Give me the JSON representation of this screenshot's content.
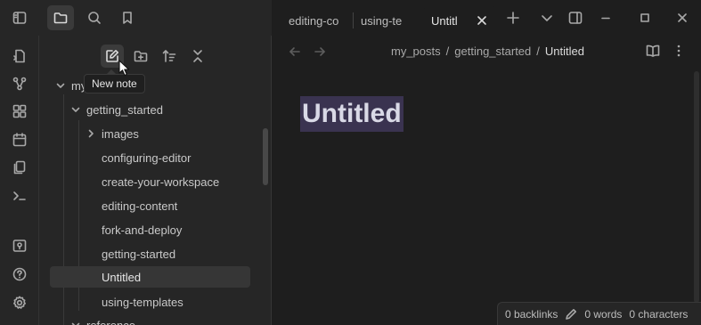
{
  "titlebar": {
    "tabs": [
      {
        "label": "editing-co",
        "active": false
      },
      {
        "label": "using-te",
        "active": false
      },
      {
        "label": "Untitl",
        "active": true
      }
    ],
    "icons": [
      "sidebar-toggle-icon",
      "folder-icon",
      "search-icon",
      "bookmark-icon",
      "plus-icon",
      "chevron-down-icon",
      "right-sidebar-icon",
      "minimize-icon",
      "maximize-icon",
      "close-icon"
    ]
  },
  "ribbon": {
    "icons": [
      "quick-switch-icon",
      "graph-icon",
      "canvas-icon",
      "calendar-icon",
      "templates-icon",
      "terminal-icon",
      "vault-icon",
      "help-icon",
      "settings-icon"
    ]
  },
  "sidebar": {
    "tools": [
      "new-note-icon",
      "new-folder-icon",
      "sort-icon",
      "collapse-all-icon"
    ],
    "tooltip": "New note",
    "tree": {
      "root": "my_posts",
      "folder": "getting_started",
      "subfolder": "images",
      "files": [
        "configuring-editor",
        "create-your-workspace",
        "editing-content",
        "fork-and-deploy",
        "getting-started",
        "Untitled",
        "using-templates"
      ],
      "next_folder": "reference"
    }
  },
  "editor": {
    "breadcrumb": {
      "root": "my_posts",
      "folder": "getting_started",
      "current": "Untitled",
      "sep": "/"
    },
    "title": "Untitled"
  },
  "status": {
    "backlinks": "0 backlinks",
    "words": "0 words",
    "characters": "0 characters"
  },
  "colors": {
    "accent_selection": "#3a3350",
    "background": "#1e1e1e",
    "sidebar": "#262626"
  }
}
